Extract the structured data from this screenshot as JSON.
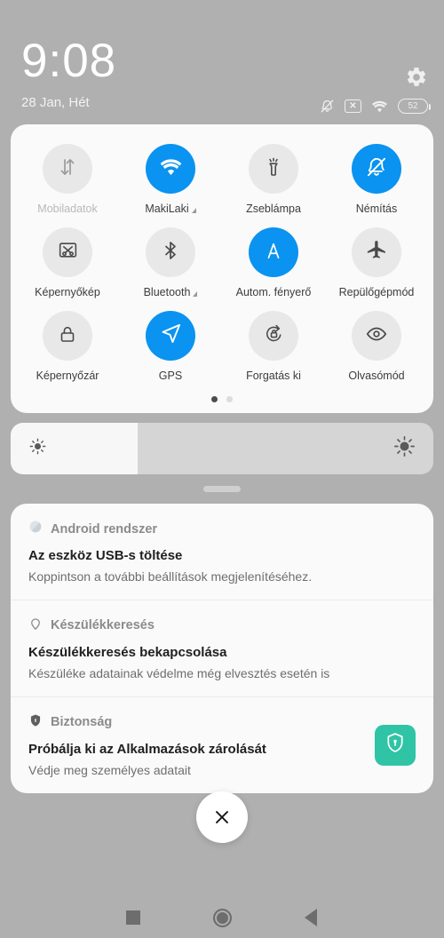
{
  "statusbar": {
    "clock": "9:08",
    "date": "28 Jan, Hét",
    "gear_icon": "gear-icon",
    "mute_icon": "bell-muted-icon",
    "nosim_icon": "no-sim-icon",
    "nosim_glyph": "✕",
    "wifi_icon": "wifi-icon",
    "battery_level": "52"
  },
  "quick_settings": {
    "tiles": [
      {
        "label": "Mobiladatok",
        "icon": "mobile-data-icon",
        "state": "disabled"
      },
      {
        "label": "MakiLaki",
        "icon": "wifi-icon",
        "state": "on",
        "has_caret": true
      },
      {
        "label": "Zseblámpa",
        "icon": "flashlight-icon",
        "state": "off"
      },
      {
        "label": "Némítás",
        "icon": "bell-muted-icon",
        "state": "on"
      },
      {
        "label": "Képernyőkép",
        "icon": "screenshot-icon",
        "state": "off"
      },
      {
        "label": "Bluetooth",
        "icon": "bluetooth-icon",
        "state": "off",
        "has_caret": true
      },
      {
        "label": "Autom. fényerő",
        "icon": "auto-brightness-icon",
        "state": "on"
      },
      {
        "label": "Repülőgépmód",
        "icon": "airplane-icon",
        "state": "off"
      },
      {
        "label": "Képernyőzár",
        "icon": "lock-icon",
        "state": "off"
      },
      {
        "label": "GPS",
        "icon": "navigation-arrow-icon",
        "state": "on"
      },
      {
        "label": "Forgatás ki",
        "icon": "rotation-lock-icon",
        "state": "off"
      },
      {
        "label": "Olvasómód",
        "icon": "eye-icon",
        "state": "off"
      }
    ],
    "pages": 2,
    "active_page": 1,
    "accent_color": "#0a93f0",
    "tile_off_color": "#e8e8e8"
  },
  "brightness": {
    "value_percent": 30,
    "low_icon": "brightness-low-icon",
    "high_icon": "brightness-high-icon"
  },
  "drag_handle": "panel-drag-handle",
  "notifications": [
    {
      "app": "Android rendszer",
      "app_icon": "android-system-icon",
      "title": "Az eszköz USB-s töltése",
      "body": "Koppintson a további beállítások megjelenítéséhez."
    },
    {
      "app": "Készülékkeresés",
      "app_icon": "location-pin-icon",
      "title": "Készülékkeresés bekapcsolása",
      "body": "Készüléke adatainak védelme még elvesztés esetén is"
    },
    {
      "app": "Biztonság",
      "app_icon": "shield-icon",
      "title": "Próbálja ki az Alkalmazások zárolását",
      "body": "Védje meg személyes adatait",
      "badge_icon": "shield-lock-icon",
      "badge_color": "#2ec4a5"
    }
  ],
  "close_button": {
    "label": "✕",
    "name": "clear-all-notifications-button"
  },
  "navbar": {
    "recents": "recents-button",
    "home": "home-button",
    "back": "back-button"
  }
}
